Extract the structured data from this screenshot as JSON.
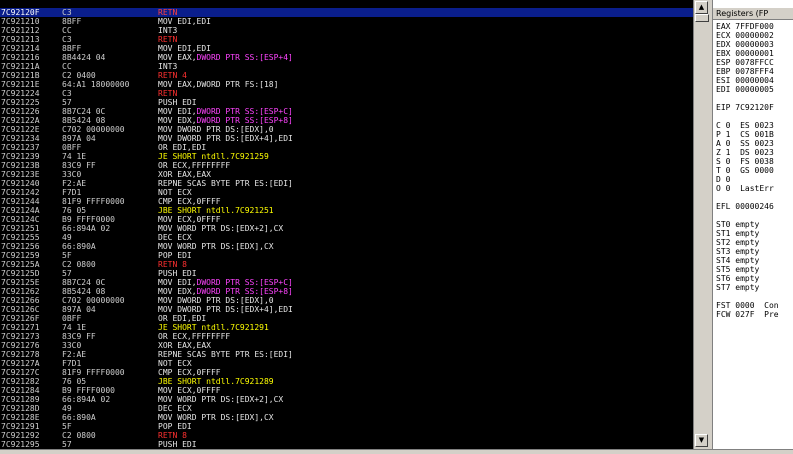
{
  "rows": [
    {
      "addr": "7C92120F",
      "bytes": "C3",
      "mnem": "RETN",
      "operand": "",
      "cls": "ret",
      "selected": true
    },
    {
      "addr": "7C921210",
      "bytes": "8BFF",
      "mnem": "MOV EDI,EDI",
      "operand": "",
      "cls": "def"
    },
    {
      "addr": "7C921212",
      "bytes": "CC",
      "mnem": "INT3",
      "operand": "",
      "cls": "def"
    },
    {
      "addr": "7C921213",
      "bytes": "C3",
      "mnem": "RETN",
      "operand": "",
      "cls": "ret"
    },
    {
      "addr": "7C921214",
      "bytes": "8BFF",
      "mnem": "MOV EDI,EDI",
      "operand": "",
      "cls": "def"
    },
    {
      "addr": "7C921216",
      "bytes": "8B4424 04",
      "mnem": "MOV EAX,",
      "operand": "DWORD PTR SS:[ESP+4]",
      "cls": "def"
    },
    {
      "addr": "7C92121A",
      "bytes": "CC",
      "mnem": "INT3",
      "operand": "",
      "cls": "def"
    },
    {
      "addr": "7C92121B",
      "bytes": "C2 0400",
      "mnem": "RETN 4",
      "operand": "",
      "cls": "ret"
    },
    {
      "addr": "7C92121E",
      "bytes": "64:A1 18000000",
      "mnem": "MOV EAX,",
      "operand": "DWORD PTR FS:[18]",
      "cls": "def",
      "opdef": true
    },
    {
      "addr": "7C921224",
      "bytes": "C3",
      "mnem": "RETN",
      "operand": "",
      "cls": "ret"
    },
    {
      "addr": "7C921225",
      "bytes": "57",
      "mnem": "PUSH EDI",
      "operand": "",
      "cls": "def"
    },
    {
      "addr": "7C921226",
      "bytes": "8B7C24 0C",
      "mnem": "MOV EDI,",
      "operand": "DWORD PTR SS:[ESP+C]",
      "cls": "def"
    },
    {
      "addr": "7C92122A",
      "bytes": "8B5424 08",
      "mnem": "MOV EDX,",
      "operand": "DWORD PTR SS:[ESP+8]",
      "cls": "def"
    },
    {
      "addr": "7C92122E",
      "bytes": "C702 00000000",
      "mnem": "MOV DWORD PTR DS:[EDX],0",
      "operand": "",
      "cls": "def"
    },
    {
      "addr": "7C921234",
      "bytes": "897A 04",
      "mnem": "MOV DWORD PTR DS:[EDX+4],EDI",
      "operand": "",
      "cls": "def"
    },
    {
      "addr": "7C921237",
      "bytes": "0BFF",
      "mnem": "OR EDI,EDI",
      "operand": "",
      "cls": "def"
    },
    {
      "addr": "7C921239",
      "bytes": "74 1E",
      "mnem": "JE SHORT ntdll.7C921259",
      "operand": "",
      "cls": "jmp"
    },
    {
      "addr": "7C92123B",
      "bytes": "83C9 FF",
      "mnem": "OR ECX,FFFFFFFF",
      "operand": "",
      "cls": "def"
    },
    {
      "addr": "7C92123E",
      "bytes": "33C0",
      "mnem": "XOR EAX,EAX",
      "operand": "",
      "cls": "def"
    },
    {
      "addr": "7C921240",
      "bytes": "F2:AE",
      "mnem": "REPNE SCAS BYTE PTR ES:[EDI]",
      "operand": "",
      "cls": "def"
    },
    {
      "addr": "7C921242",
      "bytes": "F7D1",
      "mnem": "NOT ECX",
      "operand": "",
      "cls": "def"
    },
    {
      "addr": "7C921244",
      "bytes": "81F9 FFFF0000",
      "mnem": "CMP ECX,0FFFF",
      "operand": "",
      "cls": "def"
    },
    {
      "addr": "7C92124A",
      "bytes": "76 05",
      "mnem": "JBE SHORT ntdll.7C921251",
      "operand": "",
      "cls": "jmp"
    },
    {
      "addr": "7C92124C",
      "bytes": "B9 FFFF0000",
      "mnem": "MOV ECX,0FFFF",
      "operand": "",
      "cls": "def"
    },
    {
      "addr": "7C921251",
      "bytes": "66:894A 02",
      "mnem": "MOV WORD PTR DS:[EDX+2],CX",
      "operand": "",
      "cls": "def"
    },
    {
      "addr": "7C921255",
      "bytes": "49",
      "mnem": "DEC ECX",
      "operand": "",
      "cls": "def"
    },
    {
      "addr": "7C921256",
      "bytes": "66:890A",
      "mnem": "MOV WORD PTR DS:[EDX],CX",
      "operand": "",
      "cls": "def"
    },
    {
      "addr": "7C921259",
      "bytes": "5F",
      "mnem": "POP EDI",
      "operand": "",
      "cls": "def"
    },
    {
      "addr": "7C92125A",
      "bytes": "C2 0800",
      "mnem": "RETN 8",
      "operand": "",
      "cls": "ret"
    },
    {
      "addr": "7C92125D",
      "bytes": "57",
      "mnem": "PUSH EDI",
      "operand": "",
      "cls": "def"
    },
    {
      "addr": "7C92125E",
      "bytes": "8B7C24 0C",
      "mnem": "MOV EDI,",
      "operand": "DWORD PTR SS:[ESP+C]",
      "cls": "def"
    },
    {
      "addr": "7C921262",
      "bytes": "8B5424 08",
      "mnem": "MOV EDX,",
      "operand": "DWORD PTR SS:[ESP+8]",
      "cls": "def"
    },
    {
      "addr": "7C921266",
      "bytes": "C702 00000000",
      "mnem": "MOV DWORD PTR DS:[EDX],0",
      "operand": "",
      "cls": "def"
    },
    {
      "addr": "7C92126C",
      "bytes": "897A 04",
      "mnem": "MOV DWORD PTR DS:[EDX+4],EDI",
      "operand": "",
      "cls": "def"
    },
    {
      "addr": "7C92126F",
      "bytes": "0BFF",
      "mnem": "OR EDI,EDI",
      "operand": "",
      "cls": "def"
    },
    {
      "addr": "7C921271",
      "bytes": "74 1E",
      "mnem": "JE SHORT ntdll.7C921291",
      "operand": "",
      "cls": "jmp"
    },
    {
      "addr": "7C921273",
      "bytes": "83C9 FF",
      "mnem": "OR ECX,FFFFFFFF",
      "operand": "",
      "cls": "def"
    },
    {
      "addr": "7C921276",
      "bytes": "33C0",
      "mnem": "XOR EAX,EAX",
      "operand": "",
      "cls": "def"
    },
    {
      "addr": "7C921278",
      "bytes": "F2:AE",
      "mnem": "REPNE SCAS BYTE PTR ES:[EDI]",
      "operand": "",
      "cls": "def"
    },
    {
      "addr": "7C92127A",
      "bytes": "F7D1",
      "mnem": "NOT ECX",
      "operand": "",
      "cls": "def"
    },
    {
      "addr": "7C92127C",
      "bytes": "81F9 FFFF0000",
      "mnem": "CMP ECX,0FFFF",
      "operand": "",
      "cls": "def"
    },
    {
      "addr": "7C921282",
      "bytes": "76 05",
      "mnem": "JBE SHORT ntdll.7C921289",
      "operand": "",
      "cls": "jmp"
    },
    {
      "addr": "7C921284",
      "bytes": "B9 FFFF0000",
      "mnem": "MOV ECX,0FFFF",
      "operand": "",
      "cls": "def"
    },
    {
      "addr": "7C921289",
      "bytes": "66:894A 02",
      "mnem": "MOV WORD PTR DS:[EDX+2],CX",
      "operand": "",
      "cls": "def"
    },
    {
      "addr": "7C92128D",
      "bytes": "49",
      "mnem": "DEC ECX",
      "operand": "",
      "cls": "def"
    },
    {
      "addr": "7C92128E",
      "bytes": "66:890A",
      "mnem": "MOV WORD PTR DS:[EDX],CX",
      "operand": "",
      "cls": "def"
    },
    {
      "addr": "7C921291",
      "bytes": "5F",
      "mnem": "POP EDI",
      "operand": "",
      "cls": "def"
    },
    {
      "addr": "7C921292",
      "bytes": "C2 0800",
      "mnem": "RETN 8",
      "operand": "",
      "cls": "ret"
    },
    {
      "addr": "7C921295",
      "bytes": "57",
      "mnem": "PUSH EDI",
      "operand": "",
      "cls": "def"
    }
  ],
  "scrollbar": {
    "up_glyph": "▲",
    "down_glyph": "▼"
  },
  "registers": {
    "title": "Registers (FP",
    "lines": [
      "EAX 7FFDF000",
      "ECX 00000002",
      "EDX 00000003",
      "EBX 00000001",
      "ESP 0078FFCC",
      "EBP 0078FFF4",
      "ESI 00000004",
      "EDI 00000005",
      "",
      "EIP 7C92120F",
      "",
      "C 0  ES 0023",
      "P 1  CS 001B",
      "A 0  SS 0023",
      "Z 1  DS 0023",
      "S 0  FS 0038",
      "T 0  GS 0000",
      "D 0",
      "O 0  LastErr",
      "",
      "EFL 00000246",
      "",
      "ST0 empty",
      "ST1 empty",
      "ST2 empty",
      "ST3 empty",
      "ST4 empty",
      "ST5 empty",
      "ST6 empty",
      "ST7 empty",
      "",
      "FST 0000  Con",
      "FCW 027F  Pre"
    ]
  },
  "colors": {
    "selected_bg": "#0a1e8c",
    "ret": "#ff3030",
    "jmp": "#ffff00",
    "operand": "#ff44ff"
  }
}
